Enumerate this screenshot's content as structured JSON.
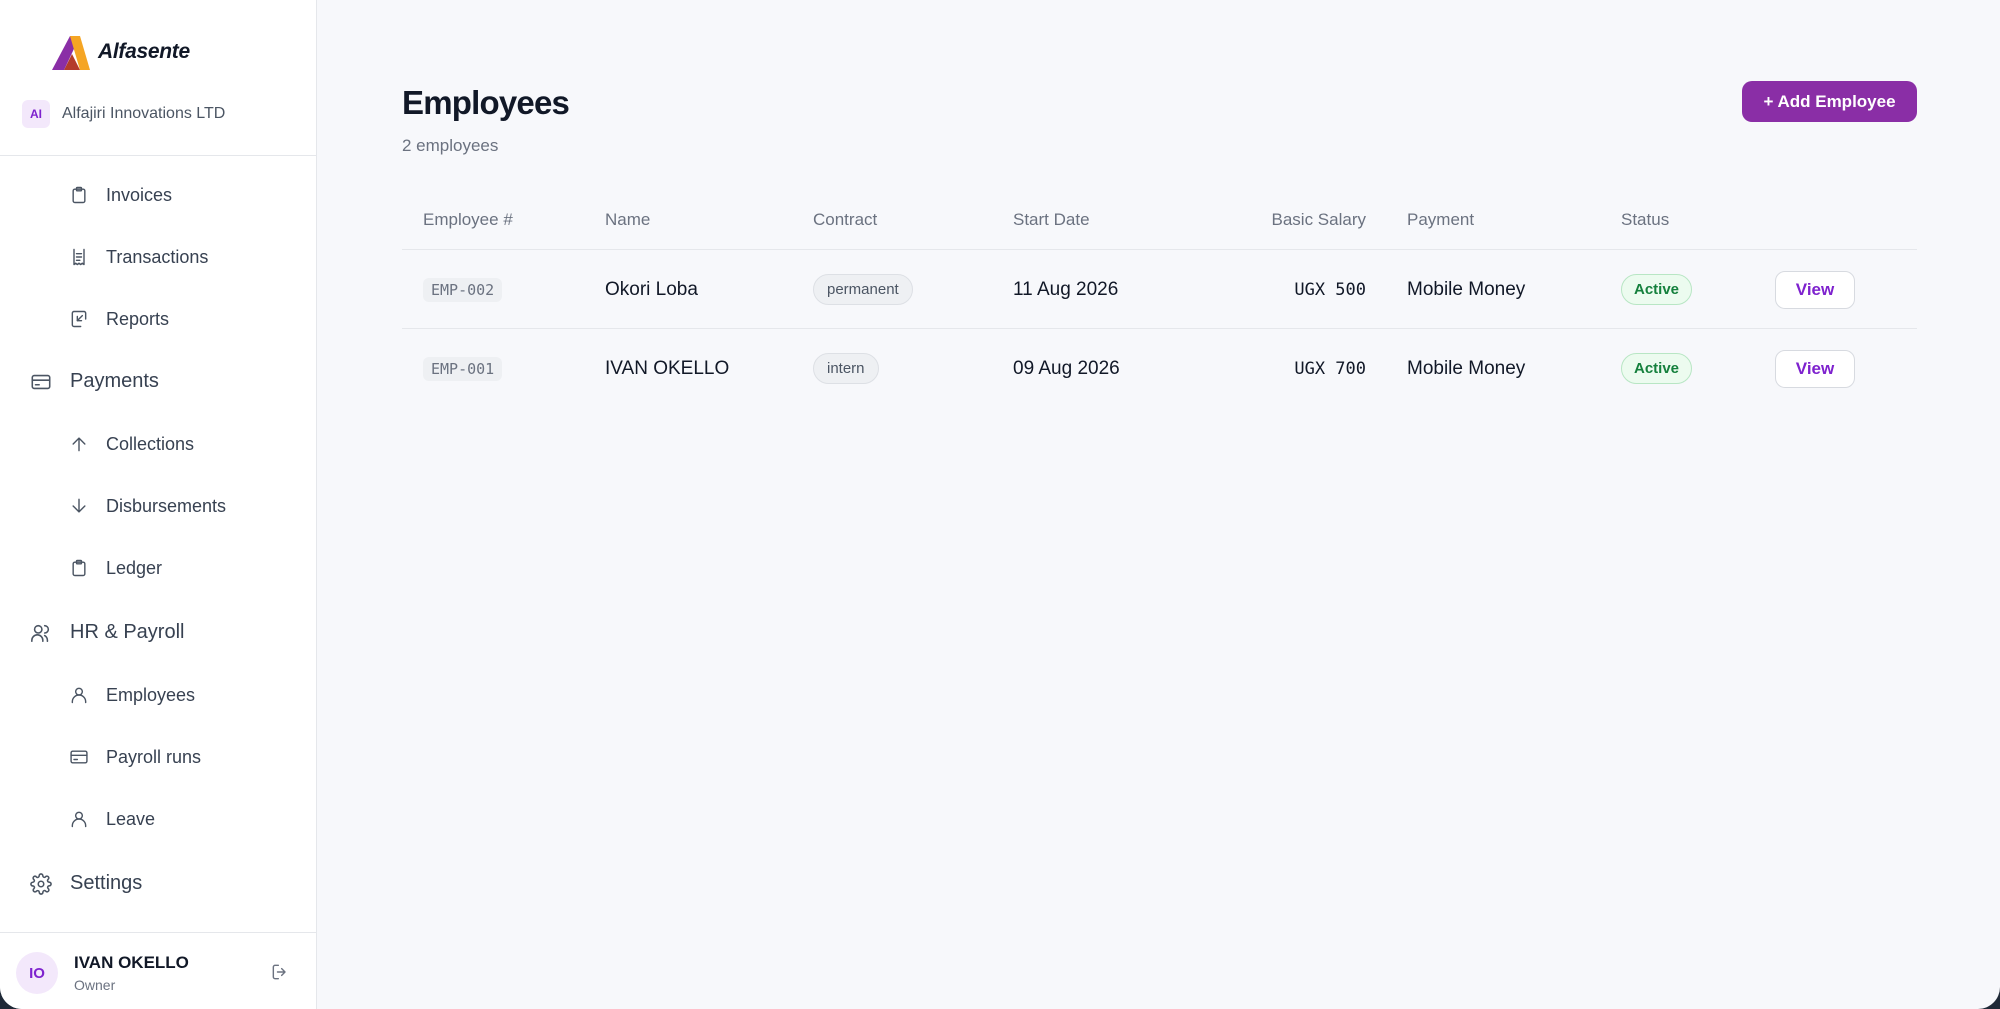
{
  "brand": {
    "name": "Alfasente",
    "logo_icon": "alfasente-logo"
  },
  "org": {
    "initials": "AI",
    "name": "Alfajiri Innovations LTD"
  },
  "sidebar": {
    "items": [
      {
        "label": "Invoices",
        "icon": "clipboard-icon",
        "level": "sub"
      },
      {
        "label": "Transactions",
        "icon": "receipt-icon",
        "level": "sub"
      },
      {
        "label": "Reports",
        "icon": "report-icon",
        "level": "sub"
      },
      {
        "label": "Payments",
        "icon": "credit-card-icon",
        "level": "group"
      },
      {
        "label": "Collections",
        "icon": "arrow-up-icon",
        "level": "sub"
      },
      {
        "label": "Disbursements",
        "icon": "arrow-down-icon",
        "level": "sub"
      },
      {
        "label": "Ledger",
        "icon": "clipboard-icon",
        "level": "sub"
      },
      {
        "label": "HR & Payroll",
        "icon": "users-icon",
        "level": "group"
      },
      {
        "label": "Employees",
        "icon": "user-icon",
        "level": "sub"
      },
      {
        "label": "Payroll runs",
        "icon": "credit-card-icon",
        "level": "sub"
      },
      {
        "label": "Leave",
        "icon": "user-icon",
        "level": "sub"
      },
      {
        "label": "Settings",
        "icon": "gear-icon",
        "level": "group"
      }
    ]
  },
  "user": {
    "initials": "IO",
    "name": "IVAN OKELLO",
    "role": "Owner",
    "logout_icon": "logout-icon"
  },
  "main": {
    "title": "Employees",
    "subtitle": "2 employees",
    "add_button": "+ Add Employee",
    "columns": [
      "Employee #",
      "Name",
      "Contract",
      "Start Date",
      "Basic Salary",
      "Payment",
      "Status"
    ],
    "rows": [
      {
        "id": "EMP-002",
        "name": "Okori Loba",
        "contract": "permanent",
        "start_date": "11 Aug 2026",
        "salary": "UGX 500",
        "payment": "Mobile Money",
        "status": "Active",
        "action": "View"
      },
      {
        "id": "EMP-001",
        "name": "IVAN OKELLO",
        "contract": "intern",
        "start_date": "09 Aug 2026",
        "salary": "UGX 700",
        "payment": "Mobile Money",
        "status": "Active",
        "action": "View"
      }
    ]
  },
  "colors": {
    "accent": "#8a2ea6",
    "status_active": "#15803d",
    "background": "#f7f8fb"
  }
}
